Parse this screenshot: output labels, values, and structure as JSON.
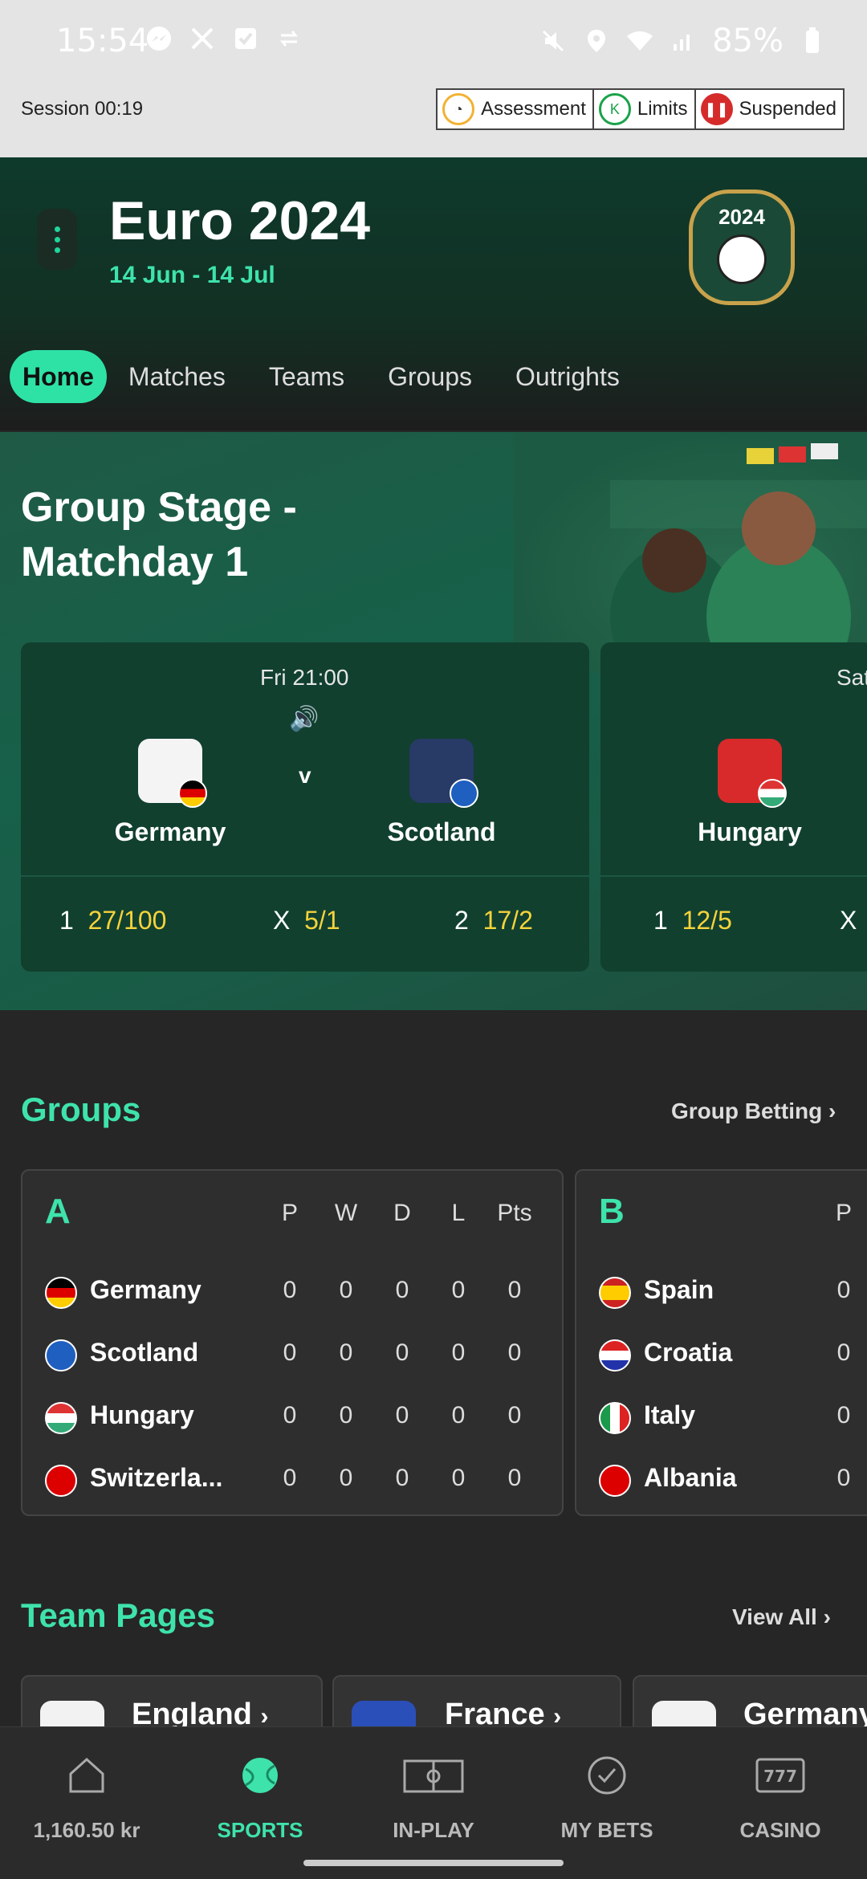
{
  "status_bar": {
    "time": "15:54",
    "battery": "85%",
    "left_icons": [
      "messenger-icon",
      "x-icon",
      "check-icon",
      "sync-icon"
    ],
    "right_icons": [
      "mute-icon",
      "location-icon",
      "wifi-icon",
      "signal-icon",
      "battery-icon"
    ]
  },
  "session": {
    "label": "Session 00:19",
    "buttons": [
      {
        "label": "Assessment",
        "icon": "gauge-icon",
        "color": "#f2b233"
      },
      {
        "label": "Limits",
        "icon": "limits-icon",
        "color": "#1ba24a"
      },
      {
        "label": "Suspended",
        "icon": "pause-icon",
        "color": "#d62b2b"
      }
    ]
  },
  "header": {
    "title": "Euro 2024",
    "dates": "14 Jun - 14 Jul",
    "logo_year": "2024"
  },
  "tabs": [
    {
      "label": "Home",
      "active": true
    },
    {
      "label": "Matches"
    },
    {
      "label": "Teams"
    },
    {
      "label": "Groups"
    },
    {
      "label": "Outrights"
    }
  ],
  "hero": {
    "title_line1": "Group Stage -",
    "title_line2": "Matchday 1",
    "matches": [
      {
        "time": "Fri 21:00",
        "home": "Germany",
        "away": "Scotland",
        "vs": "v",
        "odds": [
          {
            "label": "1",
            "value": "27/100"
          },
          {
            "label": "X",
            "value": "5/1"
          },
          {
            "label": "2",
            "value": "17/2"
          }
        ]
      },
      {
        "time": "Sat",
        "home": "Hungary",
        "odds": [
          {
            "label": "1",
            "value": "12/5"
          },
          {
            "label": "X",
            "value": ""
          }
        ]
      }
    ]
  },
  "groups": {
    "heading": "Groups",
    "link": "Group Betting",
    "columns": [
      "P",
      "W",
      "D",
      "L",
      "Pts"
    ],
    "cards": [
      {
        "letter": "A",
        "teams": [
          {
            "name": "Germany",
            "stats": [
              "0",
              "0",
              "0",
              "0",
              "0"
            ]
          },
          {
            "name": "Scotland",
            "stats": [
              "0",
              "0",
              "0",
              "0",
              "0"
            ]
          },
          {
            "name": "Hungary",
            "stats": [
              "0",
              "0",
              "0",
              "0",
              "0"
            ]
          },
          {
            "name": "Switzerla...",
            "stats": [
              "0",
              "0",
              "0",
              "0",
              "0"
            ]
          }
        ]
      },
      {
        "letter": "B",
        "teams": [
          {
            "name": "Spain",
            "stats": [
              "0"
            ]
          },
          {
            "name": "Croatia",
            "stats": [
              "0"
            ]
          },
          {
            "name": "Italy",
            "stats": [
              "0"
            ]
          },
          {
            "name": "Albania",
            "stats": [
              "0"
            ]
          }
        ]
      }
    ]
  },
  "team_pages": {
    "heading": "Team Pages",
    "link": "View All",
    "teams": [
      "England",
      "France",
      "Germany"
    ]
  },
  "bottom_nav": [
    {
      "label": "1,160.50 kr",
      "icon": "home-icon"
    },
    {
      "label": "SPORTS",
      "icon": "tennis-ball-icon",
      "active": true
    },
    {
      "label": "IN-PLAY",
      "icon": "pitch-icon"
    },
    {
      "label": "MY BETS",
      "icon": "check-circle-icon"
    },
    {
      "label": "CASINO",
      "icon": "slot-machine-icon"
    }
  ],
  "colors": {
    "accent": "#3ee3ab",
    "odds": "#f5d33b",
    "background": "#262626"
  }
}
